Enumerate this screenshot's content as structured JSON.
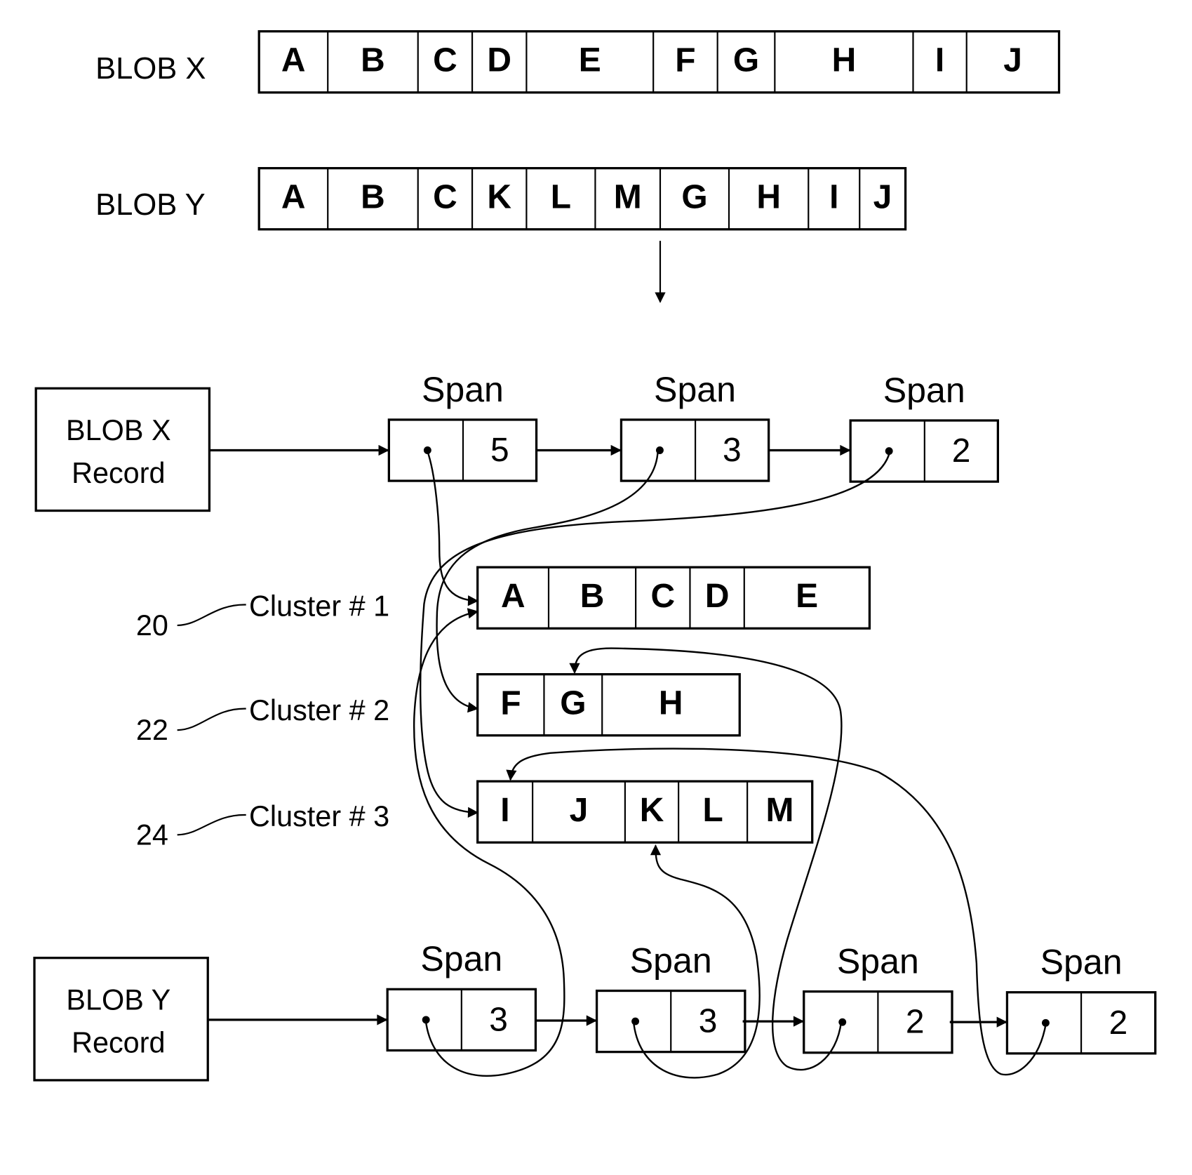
{
  "blob_x": {
    "label": "BLOB X",
    "cells": [
      "A",
      "B",
      "C",
      "D",
      "E",
      "F",
      "G",
      "H",
      "I",
      "J"
    ]
  },
  "blob_y": {
    "label": "BLOB Y",
    "cells": [
      "A",
      "B",
      "C",
      "K",
      "L",
      "M",
      "G",
      "H",
      "I",
      "J"
    ]
  },
  "blob_x_record": {
    "line1": "BLOB X",
    "line2": "Record",
    "spans": [
      {
        "title": "Span",
        "count": "5",
        "points_to": "Cluster # 1",
        "target_cell": "A"
      },
      {
        "title": "Span",
        "count": "3",
        "points_to": "Cluster # 2",
        "target_cell": "F"
      },
      {
        "title": "Span",
        "count": "2",
        "points_to": "Cluster # 3",
        "target_cell": "I"
      }
    ]
  },
  "blob_y_record": {
    "line1": "BLOB Y",
    "line2": "Record",
    "spans": [
      {
        "title": "Span",
        "count": "3",
        "points_to": "Cluster # 1",
        "target_cell": "A"
      },
      {
        "title": "Span",
        "count": "3",
        "points_to": "Cluster # 3",
        "target_cell": "K"
      },
      {
        "title": "Span",
        "count": "2",
        "points_to": "Cluster # 2",
        "target_cell": "G"
      },
      {
        "title": "Span",
        "count": "2",
        "points_to": "Cluster # 3",
        "target_cell": "I"
      }
    ]
  },
  "clusters": [
    {
      "ref": "20",
      "label": "Cluster # 1",
      "cells": [
        "A",
        "B",
        "C",
        "D",
        "E"
      ]
    },
    {
      "ref": "22",
      "label": "Cluster # 2",
      "cells": [
        "F",
        "G",
        "H"
      ]
    },
    {
      "ref": "24",
      "label": "Cluster # 3",
      "cells": [
        "I",
        "J",
        "K",
        "L",
        "M"
      ]
    }
  ]
}
